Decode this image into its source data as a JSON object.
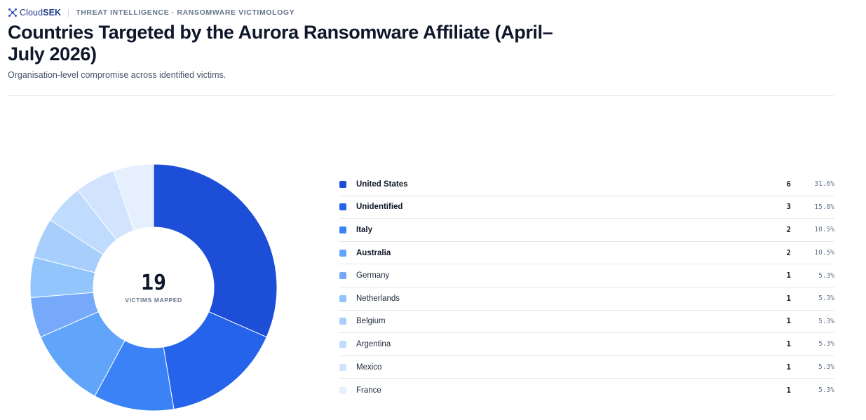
{
  "brand": {
    "logo_prefix": "Cloud",
    "logo_suffix": "SEK",
    "eyebrow": "THREAT INTELLIGENCE · RANSOMWARE VICTIMOLOGY"
  },
  "header": {
    "title": "Countries Targeted by the Aurora Ransomware Affiliate (April–July 2026)",
    "subtitle": "Organisation-level compromise across identified victims."
  },
  "center": {
    "total": "19",
    "caption": "VICTIMS MAPPED"
  },
  "chart_data": {
    "type": "pie",
    "title": "Countries Targeted by the Aurora Ransomware Affiliate (April–July 2026)",
    "categories": [
      "United States",
      "Unidentified",
      "Italy",
      "Australia",
      "Germany",
      "Netherlands",
      "Belgium",
      "Argentina",
      "Mexico",
      "France"
    ],
    "values": [
      6,
      3,
      2,
      2,
      1,
      1,
      1,
      1,
      1,
      1
    ],
    "percentages": [
      "31.6%",
      "15.8%",
      "10.5%",
      "10.5%",
      "5.3%",
      "5.3%",
      "5.3%",
      "5.3%",
      "5.3%",
      "5.3%"
    ],
    "colors": [
      "#1d4ed8",
      "#2563eb",
      "#3b82f6",
      "#60a5fa",
      "#76a9fa",
      "#93c5fd",
      "#a8cffc",
      "#bfdbfe",
      "#d2e4fd",
      "#e5effe"
    ],
    "legend_position": "right"
  }
}
